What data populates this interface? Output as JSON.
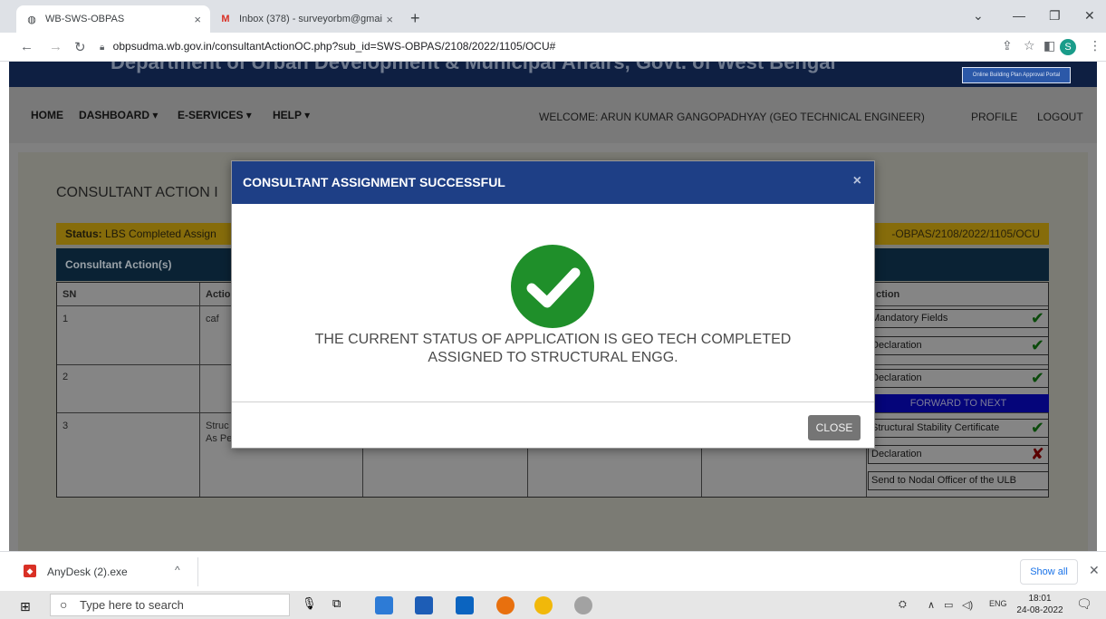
{
  "browser": {
    "tabs": [
      {
        "label": "WB-SWS-OBPAS",
        "active": true
      },
      {
        "label": "Inbox (378) - surveyorbm@gmai",
        "active": false
      }
    ],
    "url": "obpsudma.wb.gov.in/consultantActionOC.php?sub_id=SWS-OBPAS/2108/2022/1105/OCU#",
    "profile_initial": "S"
  },
  "site": {
    "header_title": "Department of Urban Development & Municipal Affairs, Govt. of West Bengal",
    "badge": "Online Building Plan Approval Portal",
    "menu": {
      "home": "HOME",
      "dashboard": "DASHBOARD ▾",
      "eservices": "E-SERVICES ▾",
      "help": "HELP ▾",
      "welcome": "WELCOME: ARUN KUMAR GANGOPADHYAY (GEO TECHNICAL ENGINEER)",
      "profile": "PROFILE",
      "logout": "LOGOUT"
    }
  },
  "main": {
    "section_title": "CONSULTANT ACTION I",
    "status_label": "Status:",
    "status_value": "LBS Completed Assign",
    "status_right": "-OBPAS/2108/2022/1105/OCU",
    "action_header": "Consultant Action(s)",
    "table": {
      "headers": {
        "sn": "SN",
        "action": "Actio",
        "action_right": "ction"
      },
      "rows": [
        {
          "sn": "1",
          "action": "caf"
        },
        {
          "sn": "2",
          "action": ""
        },
        {
          "sn": "3",
          "action_line1": "Struc",
          "action_line2": "As Pe"
        }
      ]
    },
    "actions": {
      "mandatory": "Mandatory Fields",
      "declaration1": "Declaration",
      "declaration2": "Declaration",
      "forward": "FORWARD TO NEXT",
      "stability": "Structural Stability Certificate",
      "declaration3": "Declaration",
      "nodal": "Send to Nodal Officer of the ULB"
    }
  },
  "modal": {
    "title": "CONSULTANT ASSIGNMENT SUCCESSFUL",
    "close_x": "×",
    "message_line1": "THE CURRENT STATUS OF APPLICATION IS GEO TECH COMPLETED",
    "message_line2": "ASSIGNED TO STRUCTURAL ENGG.",
    "close_button": "CLOSE",
    "check_color": "#1f8f2a"
  },
  "downloads": {
    "file": "AnyDesk (2).exe",
    "show_all": "Show all"
  },
  "taskbar": {
    "search_placeholder": "Type here to search",
    "lang": "ENG",
    "time": "18:01",
    "date": "24-08-2022"
  }
}
